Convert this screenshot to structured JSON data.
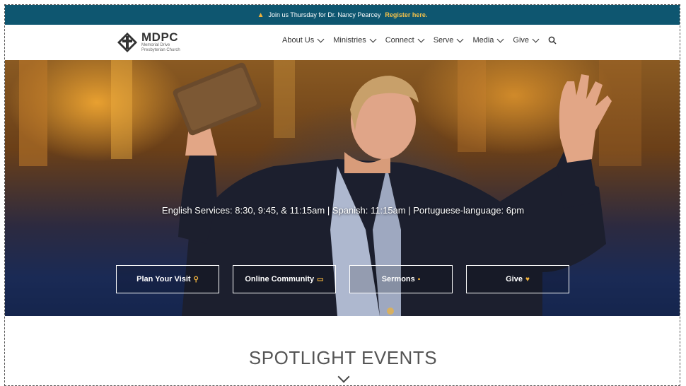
{
  "announcement": {
    "text": "Join us Thursday for Dr. Nancy Pearcey",
    "link": "Register here.",
    "icon": "bell-icon"
  },
  "logo": {
    "name": "MDPC",
    "sub_line1": "Memorial Drive",
    "sub_line2": "Presbyterian Church"
  },
  "nav": {
    "items": [
      {
        "label": "About Us"
      },
      {
        "label": "Ministries"
      },
      {
        "label": "Connect"
      },
      {
        "label": "Serve"
      },
      {
        "label": "Media"
      },
      {
        "label": "Give"
      }
    ],
    "search_icon": "search-icon"
  },
  "hero": {
    "tagline": "English Services: 8:30, 9:45, & 11:15am | Spanish: 11:15am | Portuguese-language: 6pm",
    "buttons": [
      {
        "label": "Plan Your Visit",
        "icon": "map-pin-icon",
        "glyph": "⚲"
      },
      {
        "label": "Online Community",
        "icon": "monitor-icon",
        "glyph": "▭"
      },
      {
        "label": "Sermons",
        "icon": "book-icon",
        "glyph": "▪"
      },
      {
        "label": "Give",
        "icon": "heart-icon",
        "glyph": "♥"
      }
    ]
  },
  "spotlight": {
    "title": "SPOTLIGHT EVENTS"
  },
  "colors": {
    "announcement_bg": "#0e5670",
    "accent": "#f2b33d"
  }
}
